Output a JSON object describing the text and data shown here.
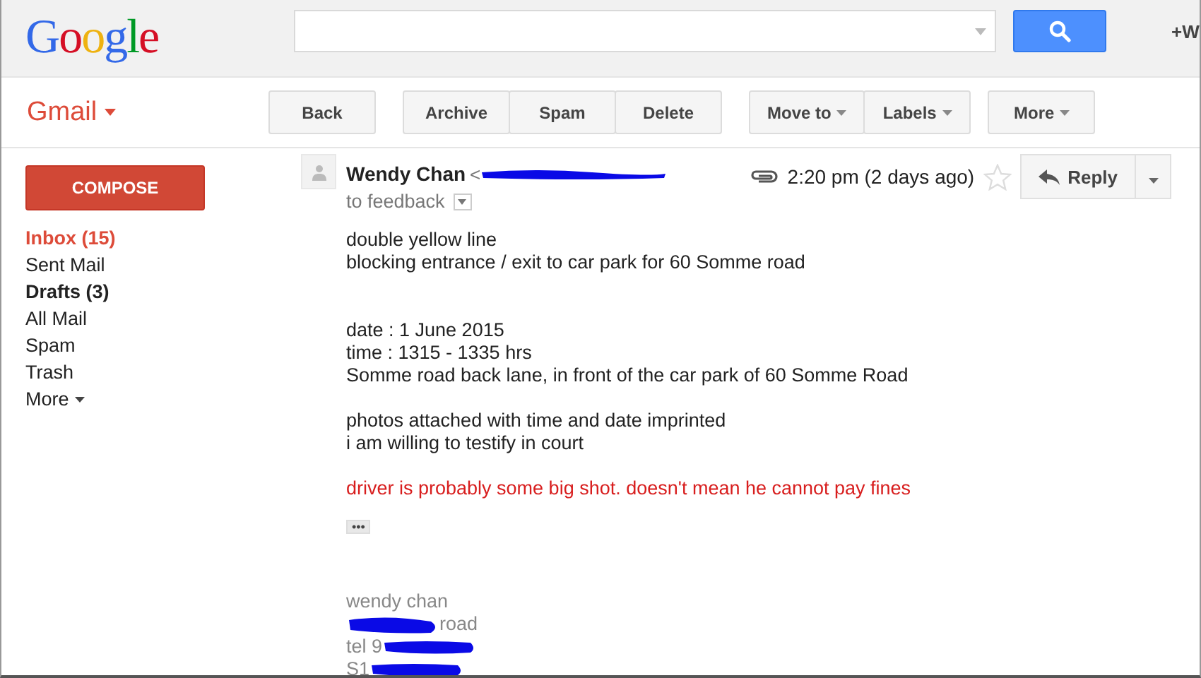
{
  "header": {
    "logo": "Google",
    "account": "+W"
  },
  "toolbar": {
    "app_menu": "Gmail",
    "groups": [
      [
        {
          "label": "Back",
          "dropdown": false
        }
      ],
      [
        {
          "label": "Archive",
          "dropdown": false
        },
        {
          "label": "Spam",
          "dropdown": false
        },
        {
          "label": "Delete",
          "dropdown": false
        }
      ],
      [
        {
          "label": "Move to",
          "dropdown": true
        },
        {
          "label": "Labels",
          "dropdown": true
        }
      ],
      [
        {
          "label": "More",
          "dropdown": true
        }
      ]
    ]
  },
  "sidebar": {
    "compose": "COMPOSE",
    "items": [
      {
        "label": "Inbox (15)",
        "selected": true,
        "bold": true,
        "dropdown": false
      },
      {
        "label": "Sent Mail",
        "selected": false,
        "bold": false,
        "dropdown": false
      },
      {
        "label": "Drafts (3)",
        "selected": false,
        "bold": true,
        "dropdown": false
      },
      {
        "label": "All Mail",
        "selected": false,
        "bold": false,
        "dropdown": false
      },
      {
        "label": "Spam",
        "selected": false,
        "bold": false,
        "dropdown": false
      },
      {
        "label": "Trash",
        "selected": false,
        "bold": false,
        "dropdown": false
      },
      {
        "label": "More",
        "selected": false,
        "bold": false,
        "dropdown": true
      }
    ]
  },
  "message": {
    "sender": "Wendy Chan",
    "sender_email": "<",
    "time": "2:20 pm (2 days ago)",
    "has_attachment": true,
    "starred": false,
    "reply": "Reply",
    "recipients": "to feedback",
    "body": [
      {
        "kind": "normal",
        "lines": [
          "double yellow line",
          "blocking entrance / exit to car park for 60 Somme road"
        ]
      },
      {
        "kind": "normal",
        "lines": [
          "date  : 1 June 2015",
          "time :  1315 - 1335 hrs",
          "Somme road back lane, in front of the car park of 60 Somme Road"
        ]
      },
      {
        "kind": "normal",
        "lines": [
          "photos attached with time and date imprinted",
          "i am willing to testify in court"
        ]
      },
      {
        "kind": "highlight",
        "lines": [
          "driver is probably some big shot. doesn't mean he cannot pay fines"
        ]
      }
    ],
    "more_button": "•••",
    "signature": [
      {
        "text": "wendy chan",
        "kind": "plain"
      },
      {
        "text": "road",
        "kind": "masked_before"
      },
      {
        "text": "tel 9",
        "kind": "masked_after"
      },
      {
        "text": "S1",
        "kind": "masked_after"
      }
    ]
  }
}
